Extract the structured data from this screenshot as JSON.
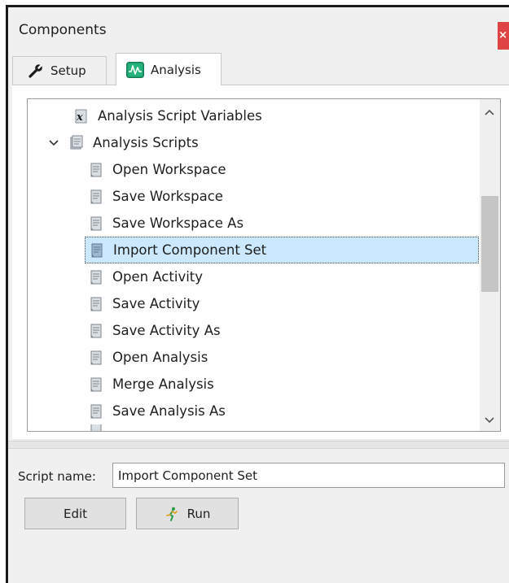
{
  "panel": {
    "title": "Components",
    "close_glyph": "×"
  },
  "tabs": [
    {
      "label": "Setup",
      "icon": "wrench-icon",
      "selected": false
    },
    {
      "label": "Analysis",
      "icon": "waveform-icon",
      "selected": true
    }
  ],
  "tree": {
    "items": [
      {
        "label": "Analysis Script Variables",
        "level": 0,
        "icon": "variable-script-icon",
        "expanded": null,
        "selected": false
      },
      {
        "label": "Analysis Scripts",
        "level": 0,
        "icon": "script-folder-icon",
        "expanded": true,
        "selected": false
      },
      {
        "label": "Open Workspace",
        "level": 1,
        "icon": "script-icon",
        "selected": false
      },
      {
        "label": "Save Workspace",
        "level": 1,
        "icon": "script-icon",
        "selected": false
      },
      {
        "label": "Save Workspace As",
        "level": 1,
        "icon": "script-icon",
        "selected": false
      },
      {
        "label": "Import Component Set",
        "level": 1,
        "icon": "script-icon",
        "selected": true
      },
      {
        "label": "Open Activity",
        "level": 1,
        "icon": "script-icon",
        "selected": false
      },
      {
        "label": "Save Activity",
        "level": 1,
        "icon": "script-icon",
        "selected": false
      },
      {
        "label": "Save Activity As",
        "level": 1,
        "icon": "script-icon",
        "selected": false
      },
      {
        "label": "Open Analysis",
        "level": 1,
        "icon": "script-icon",
        "selected": false
      },
      {
        "label": "Merge Analysis",
        "level": 1,
        "icon": "script-icon",
        "selected": false
      },
      {
        "label": "Save Analysis As",
        "level": 1,
        "icon": "script-icon",
        "selected": false
      }
    ]
  },
  "script_name": {
    "label": "Script name:",
    "value": "Import Component Set"
  },
  "buttons": {
    "edit_label": "Edit",
    "run_label": "Run"
  },
  "colors": {
    "selection": "#cce8ff",
    "close": "#e04343",
    "analysis_icon": "#1e9e6e"
  }
}
